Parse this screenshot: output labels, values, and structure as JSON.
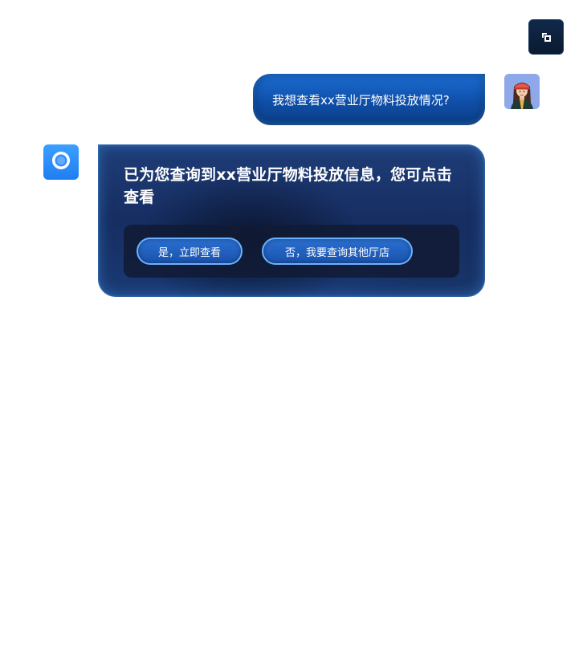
{
  "toolbar": {
    "expand_icon": "expand-icon"
  },
  "user_message": {
    "text": "我想查看xx营业厅物料投放情况?",
    "avatar_icon": "user-avatar"
  },
  "bot_message": {
    "avatar_icon": "assistant-logo-icon",
    "text": "已为您查询到xx营业厅物料投放信息，您可点击查看",
    "actions": [
      {
        "label": "是，立即查看"
      },
      {
        "label": "否，我要查询其他厅店"
      }
    ]
  },
  "colors": {
    "user_bubble": "#1c6fd6",
    "bot_card": "#1f3d78",
    "pill_border": "#6ab0ff",
    "bot_avatar": "#2a8cff"
  }
}
